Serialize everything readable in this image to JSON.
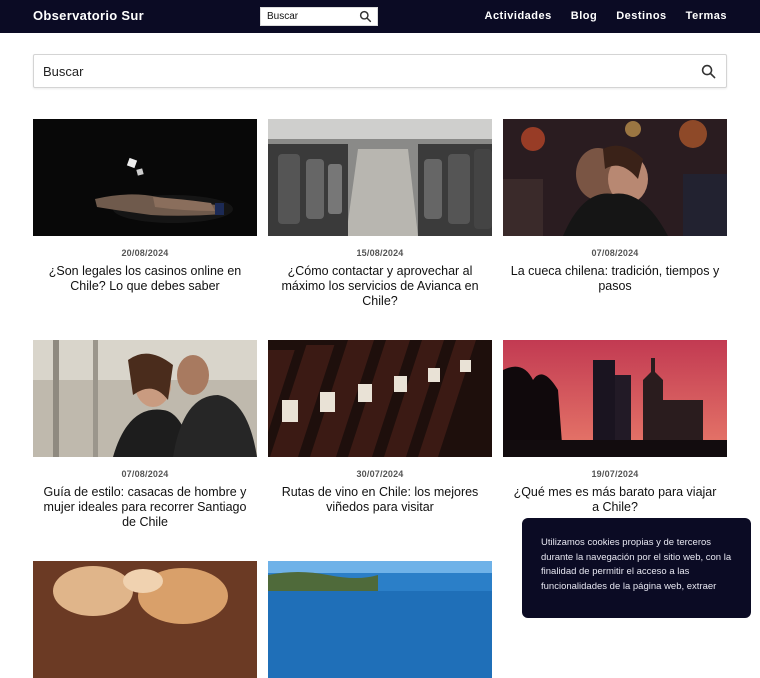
{
  "header": {
    "brand": "Observatorio Sur",
    "search_placeholder": "Buscar",
    "nav": [
      "Actividades",
      "Blog",
      "Destinos",
      "Termas"
    ]
  },
  "main_search": {
    "placeholder": "Buscar"
  },
  "posts": [
    {
      "date": "20/08/2024",
      "title": "¿Son legales los casinos online en Chile? Lo que debes saber",
      "image": "hand-with-dice"
    },
    {
      "date": "15/08/2024",
      "title": "¿Cómo contactar y aprovechar al máximo los servicios de Avianca en Chile?",
      "image": "airplane-cabin"
    },
    {
      "date": "07/08/2024",
      "title": "La cueca chilena: tradición, tiempos y pasos",
      "image": "couple-dancing"
    },
    {
      "date": "07/08/2024",
      "title": "Guía de estilo: casacas de hombre y mujer ideales para recorrer Santiago de Chile",
      "image": "couple-leather-jackets"
    },
    {
      "date": "30/07/2024",
      "title": "Rutas de vino en Chile: los mejores viñedos para visitar",
      "image": "wine-bottles"
    },
    {
      "date": "19/07/2024",
      "title": "¿Qué mes es más barato para viajar a Chile?",
      "image": "santiago-sunset"
    },
    {
      "image": "food-plate"
    },
    {
      "image": "coast-sea"
    }
  ],
  "cookie_banner": {
    "text": "Utilizamos cookies propias y de terceros durante la navegación por el sitio web, con la finalidad de permitir el acceso a las funcionalidades de la página web, extraer"
  },
  "colors": {
    "navbar": "#0b0b24",
    "cookie_bg": "#0b0b24"
  },
  "icons": [
    "search-icon"
  ]
}
